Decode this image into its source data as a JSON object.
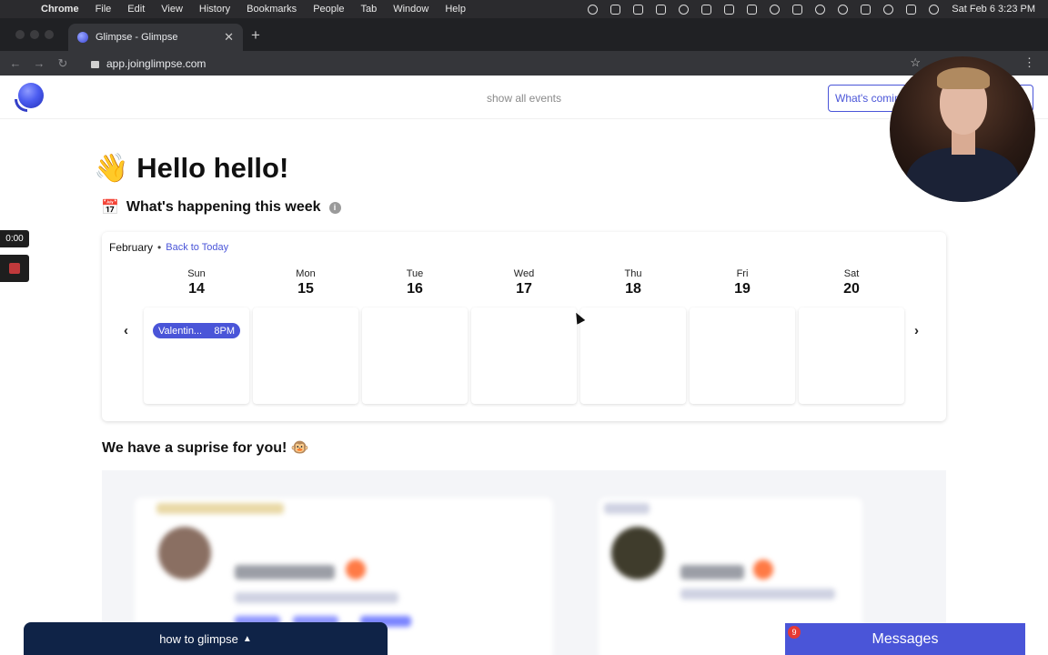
{
  "menubar": {
    "app": "Chrome",
    "items": [
      "File",
      "Edit",
      "View",
      "History",
      "Bookmarks",
      "People",
      "Tab",
      "Window",
      "Help"
    ],
    "clock": "Sat Feb 6  3:23 PM"
  },
  "browser": {
    "tab_title": "Glimpse - Glimpse",
    "url": "app.joinglimpse.com"
  },
  "header": {
    "show_all_events": "show all events",
    "whats_coming": "What's comin"
  },
  "recorder": {
    "timer": "0:00"
  },
  "main": {
    "greeting_emoji": "👋",
    "greeting": "Hello hello!",
    "week_emoji": "📅",
    "week_title": "What's happening this week",
    "info_icon": "i",
    "surprise_title": "We have a suprise for you! 🐵"
  },
  "calendar": {
    "month": "February",
    "separator": "•",
    "back_to_today": "Back to Today",
    "days": [
      {
        "name": "Sun",
        "num": "14"
      },
      {
        "name": "Mon",
        "num": "15"
      },
      {
        "name": "Tue",
        "num": "16"
      },
      {
        "name": "Wed",
        "num": "17"
      },
      {
        "name": "Thu",
        "num": "18"
      },
      {
        "name": "Fri",
        "num": "19"
      },
      {
        "name": "Sat",
        "num": "20"
      }
    ],
    "event": {
      "title": "Valentin...",
      "time": "8PM",
      "day": "Sun"
    },
    "prev_arrow": "‹",
    "next_arrow": "›"
  },
  "bottom": {
    "howto": "how to glimpse",
    "messages": "Messages",
    "message_count": "9"
  },
  "colors": {
    "accent": "#4a55d8",
    "howto_bg": "#0f2347",
    "badge": "#e53935"
  },
  "icons": [
    "apple-icon",
    "lock-icon",
    "star-icon",
    "info-icon",
    "chevron-left-icon",
    "chevron-right-icon",
    "chevron-up-icon"
  ]
}
